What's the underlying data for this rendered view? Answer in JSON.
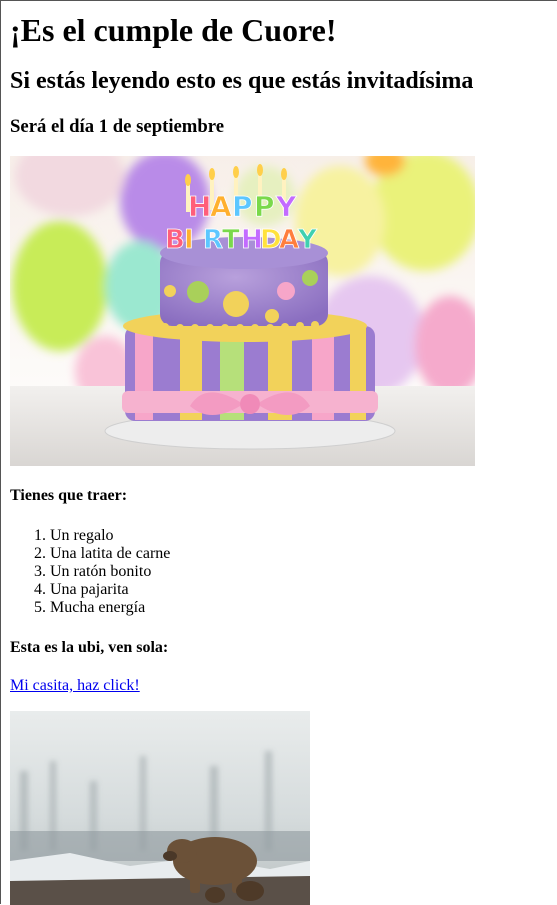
{
  "heading": "¡Es el cumple de Cuore!",
  "subheading": "Si estás leyendo esto es que estás invitadísima",
  "date_line": "Será el día 1 de septiembre",
  "cake_image": {
    "topper_letters_line1": [
      "H",
      "A",
      "P",
      "P",
      "Y"
    ],
    "topper_letters_line2": [
      "B",
      "I",
      "R",
      "T",
      "H",
      "D",
      "A",
      "Y"
    ],
    "topper_colors": [
      "#ff5e7a",
      "#ffb02e",
      "#5cc7ff",
      "#7ad94a",
      "#c36bff",
      "#ffe23d",
      "#ff7e3d",
      "#40d0b0"
    ]
  },
  "bring_title": "Tienes que traer:",
  "bring_items": [
    "Un regalo",
    "Una latita de carne",
    "Un ratón bonito",
    "Una pajarita",
    "Mucha energía"
  ],
  "location_title": "Esta es la ubi, ven sola:",
  "location_link": "Mi casita, haz click!",
  "colors": {
    "link": "#0000ee",
    "text": "#000000",
    "background": "#ffffff"
  }
}
